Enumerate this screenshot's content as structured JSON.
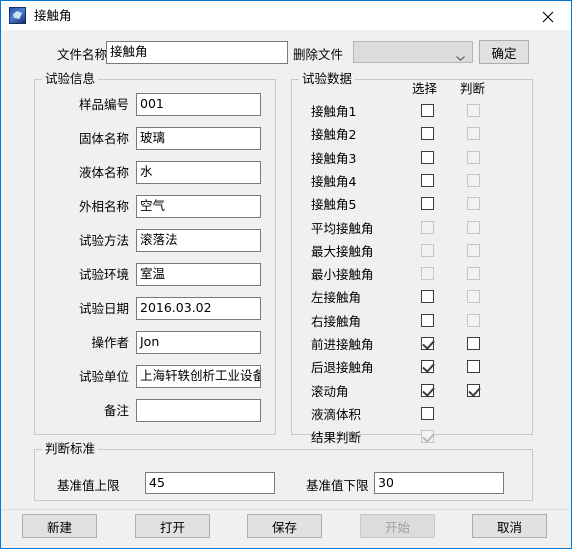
{
  "window": {
    "title": "接触角",
    "icon": "app-icon",
    "close_label": "close-icon"
  },
  "filebar": {
    "file_name_label": "文件名称",
    "file_name_value": "接触角",
    "delete_file_label": "删除文件",
    "delete_file_value": "",
    "delete_file_enabled": false,
    "confirm_label": "确定"
  },
  "test_info": {
    "title": "试验信息",
    "fields": [
      {
        "label": "样品编号",
        "value": "001"
      },
      {
        "label": "固体名称",
        "value": "玻璃"
      },
      {
        "label": "液体名称",
        "value": "水"
      },
      {
        "label": "外相名称",
        "value": "空气"
      },
      {
        "label": "试验方法",
        "value": "滚落法"
      },
      {
        "label": "试验环境",
        "value": "室温"
      },
      {
        "label": "试验日期",
        "value": "2016.03.02"
      },
      {
        "label": "操作者",
        "value": "Jon"
      },
      {
        "label": "试验单位",
        "value": "上海轩轶创析工业设备"
      },
      {
        "label": "备注",
        "value": ""
      }
    ]
  },
  "test_data": {
    "title": "试验数据",
    "col_select": "选择",
    "col_judge": "判断",
    "rows": [
      {
        "label": "接触角1",
        "select": {
          "checked": false,
          "enabled": true,
          "visible": true
        },
        "judge": {
          "checked": false,
          "enabled": false,
          "visible": true
        }
      },
      {
        "label": "接触角2",
        "select": {
          "checked": false,
          "enabled": true,
          "visible": true
        },
        "judge": {
          "checked": false,
          "enabled": false,
          "visible": true
        }
      },
      {
        "label": "接触角3",
        "select": {
          "checked": false,
          "enabled": true,
          "visible": true
        },
        "judge": {
          "checked": false,
          "enabled": false,
          "visible": true
        }
      },
      {
        "label": "接触角4",
        "select": {
          "checked": false,
          "enabled": true,
          "visible": true
        },
        "judge": {
          "checked": false,
          "enabled": false,
          "visible": true
        }
      },
      {
        "label": "接触角5",
        "select": {
          "checked": false,
          "enabled": true,
          "visible": true
        },
        "judge": {
          "checked": false,
          "enabled": false,
          "visible": true
        }
      },
      {
        "label": "平均接触角",
        "select": {
          "checked": false,
          "enabled": false,
          "visible": true
        },
        "judge": {
          "checked": false,
          "enabled": false,
          "visible": true
        }
      },
      {
        "label": "最大接触角",
        "select": {
          "checked": false,
          "enabled": false,
          "visible": true
        },
        "judge": {
          "checked": false,
          "enabled": false,
          "visible": true
        }
      },
      {
        "label": "最小接触角",
        "select": {
          "checked": false,
          "enabled": false,
          "visible": true
        },
        "judge": {
          "checked": false,
          "enabled": false,
          "visible": true
        }
      },
      {
        "label": "左接触角",
        "select": {
          "checked": false,
          "enabled": true,
          "visible": true
        },
        "judge": {
          "checked": false,
          "enabled": false,
          "visible": true
        }
      },
      {
        "label": "右接触角",
        "select": {
          "checked": false,
          "enabled": true,
          "visible": true
        },
        "judge": {
          "checked": false,
          "enabled": false,
          "visible": true
        }
      },
      {
        "label": "前进接触角",
        "select": {
          "checked": true,
          "enabled": true,
          "visible": true
        },
        "judge": {
          "checked": false,
          "enabled": true,
          "visible": true
        }
      },
      {
        "label": "后退接触角",
        "select": {
          "checked": true,
          "enabled": true,
          "visible": true
        },
        "judge": {
          "checked": false,
          "enabled": true,
          "visible": true
        }
      },
      {
        "label": "滚动角",
        "select": {
          "checked": true,
          "enabled": true,
          "visible": true
        },
        "judge": {
          "checked": true,
          "enabled": true,
          "visible": true
        }
      },
      {
        "label": "液滴体积",
        "select": {
          "checked": false,
          "enabled": true,
          "visible": true
        },
        "judge": {
          "checked": false,
          "enabled": false,
          "visible": false
        }
      },
      {
        "label": "结果判断",
        "select": {
          "checked": true,
          "enabled": false,
          "visible": true
        },
        "judge": {
          "checked": false,
          "enabled": false,
          "visible": false
        }
      }
    ]
  },
  "criteria": {
    "title": "判断标准",
    "upper_label": "基准值上限",
    "upper_value": "45",
    "lower_label": "基准值下限",
    "lower_value": "30"
  },
  "footer": {
    "new_label": "新建",
    "open_label": "打开",
    "save_label": "保存",
    "start_label": "开始",
    "start_enabled": false,
    "cancel_label": "取消"
  }
}
